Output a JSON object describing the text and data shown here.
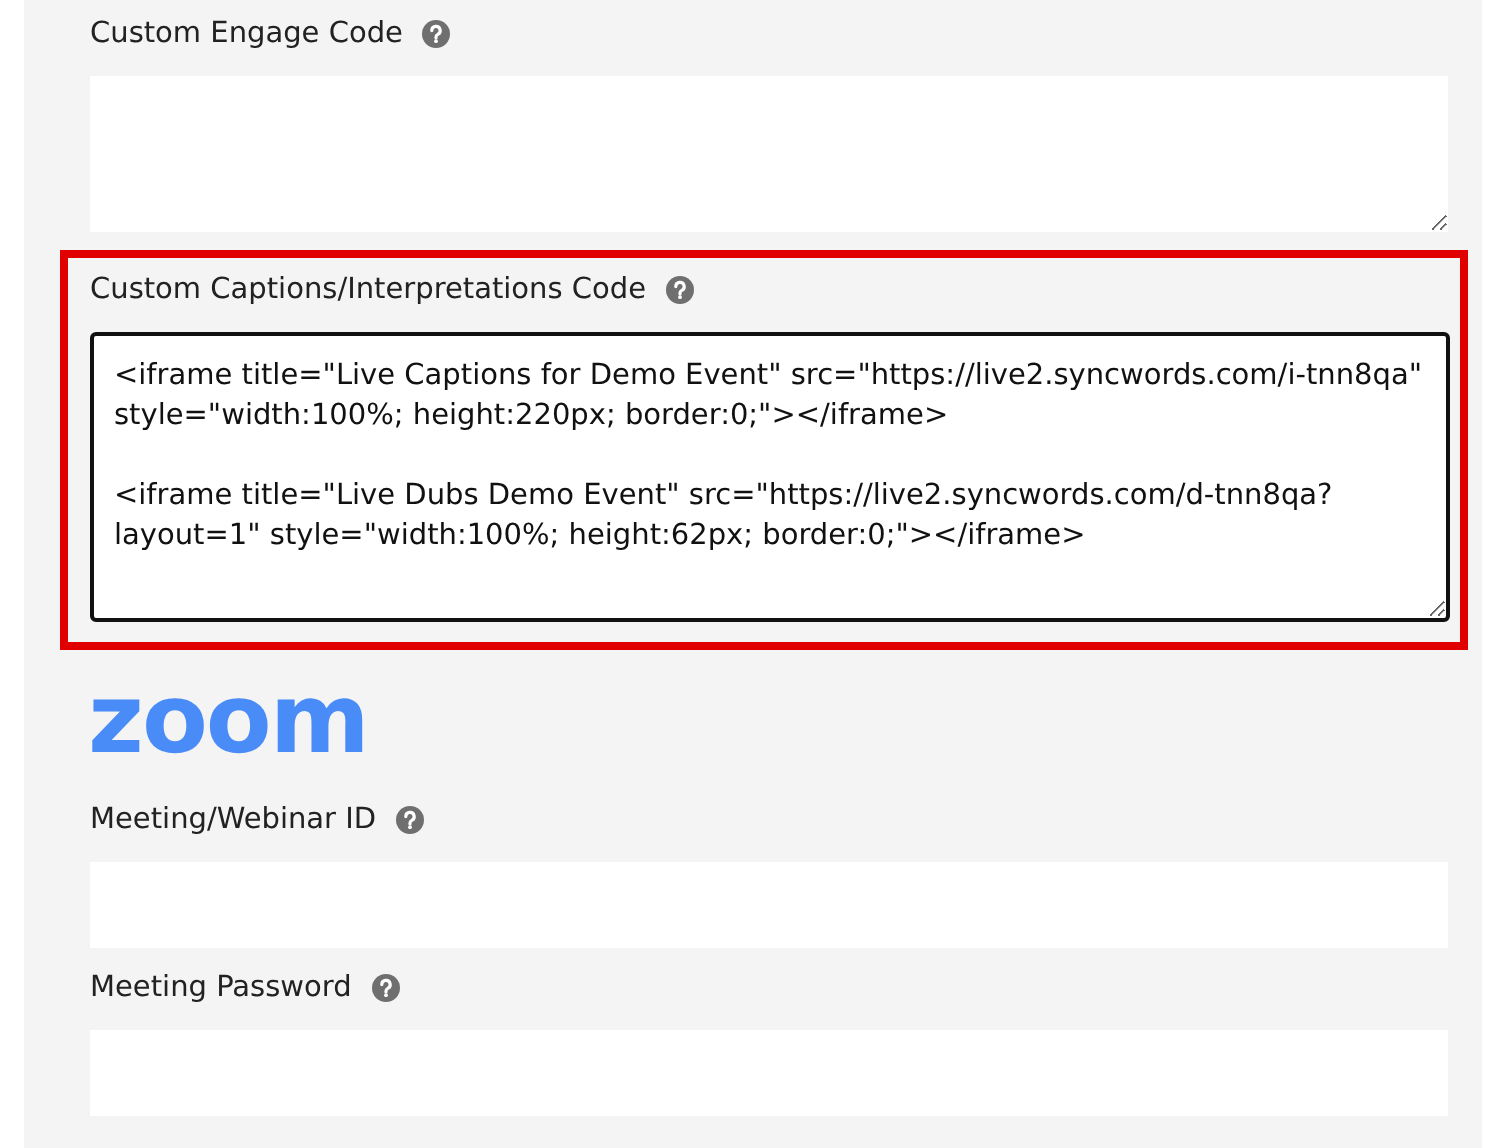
{
  "sections": [
    {
      "kind": "textarea",
      "label": "Custom Engage Code",
      "highlighted": false
    },
    {
      "kind": "textarea",
      "label": "Custom Captions/Interpretations Code",
      "highlighted": true,
      "value": "<iframe title=\"Live Captions for Demo Event\" src=\"https://live2.syncwords.com/i-tnn8qa\" style=\"width:100%; height:220px; border:0;\"></iframe>\n\n<iframe title=\"Live Dubs Demo Event\" src=\"https://live2.syncwords.com/d-tnn8qa?layout=1\" style=\"width:100%; height:62px; border:0;\"></iframe>"
    },
    {
      "kind": "logo",
      "text": "zoom"
    },
    {
      "kind": "input",
      "label": "Meeting/Webinar ID",
      "highlighted": false
    },
    {
      "kind": "input",
      "label": "Meeting Password",
      "highlighted": false
    }
  ]
}
